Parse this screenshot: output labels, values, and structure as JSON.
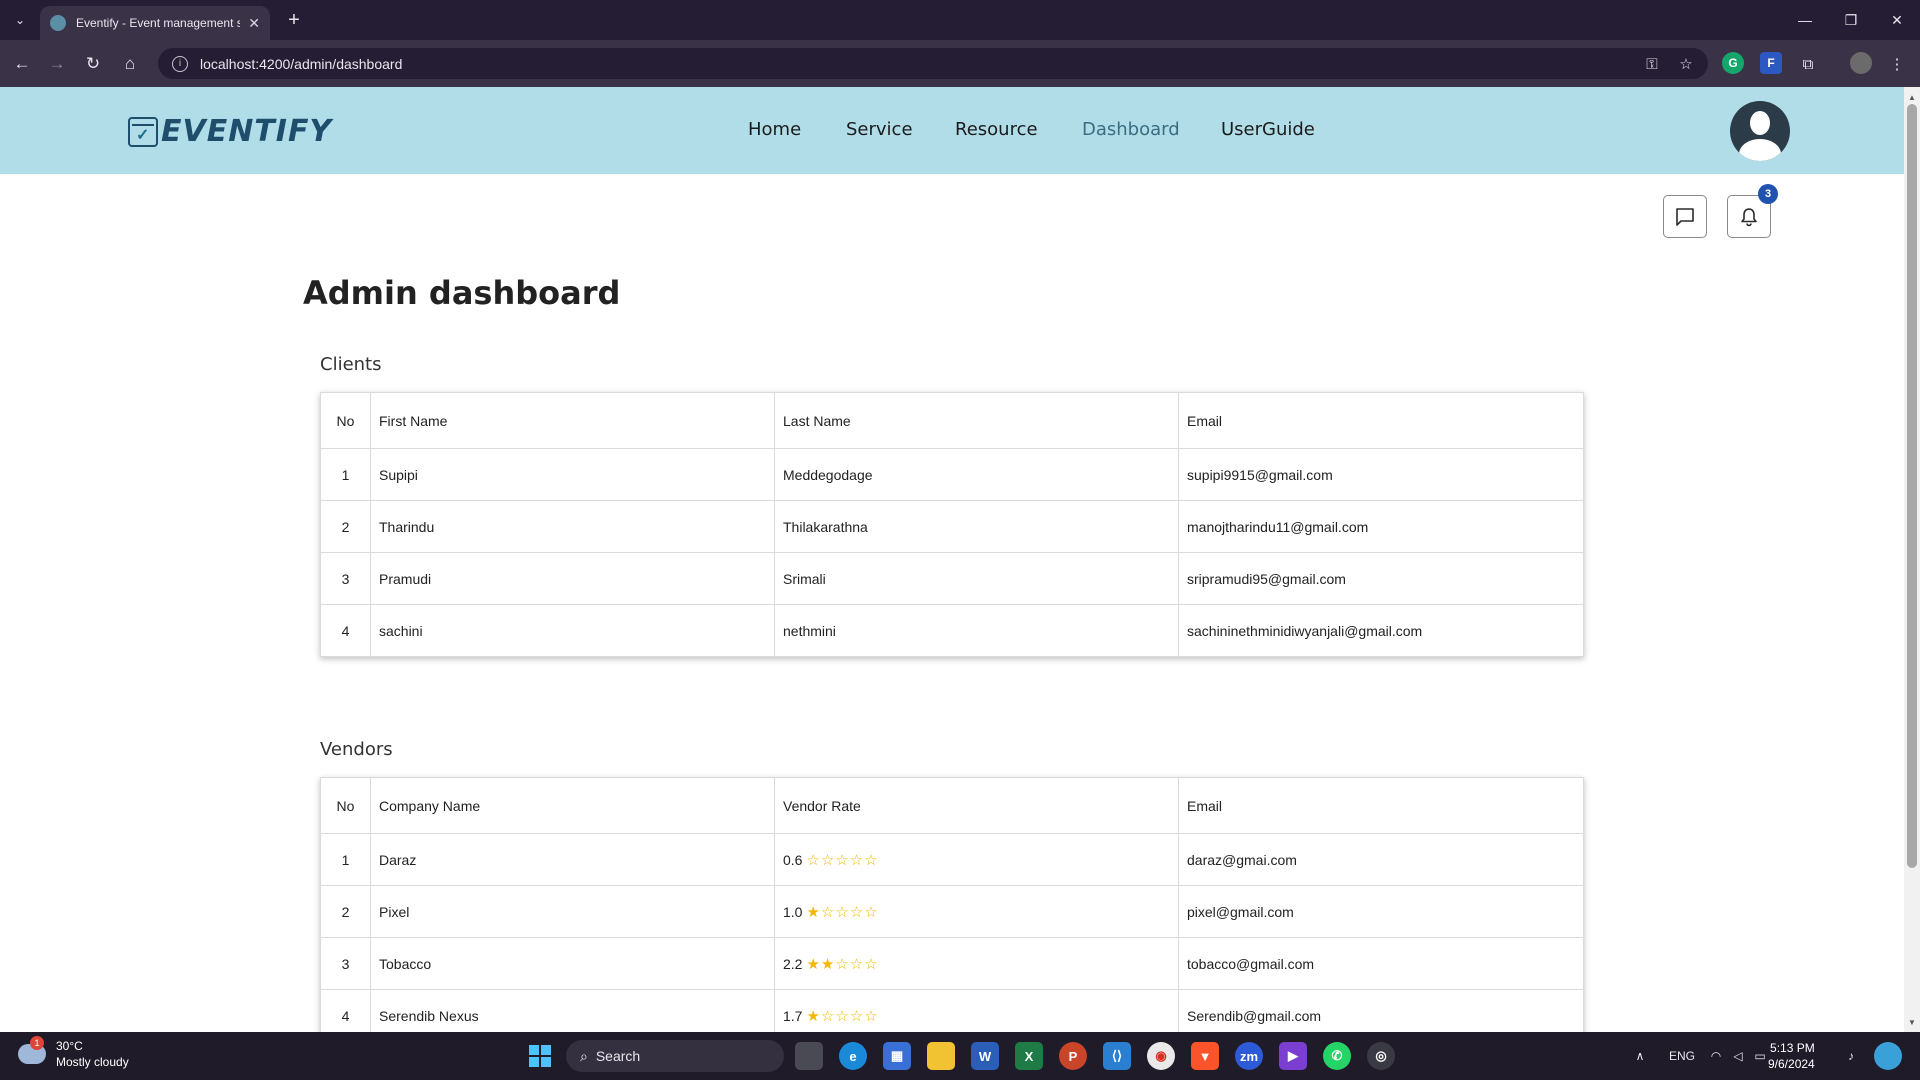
{
  "browser": {
    "tab_title": "Eventify - Event management s",
    "url": "localhost:4200/admin/dashboard",
    "new_tab": "+",
    "close_tab": "✕"
  },
  "app": {
    "logo_text": "EVENTIFY",
    "nav": [
      "Home",
      "Service",
      "Resource",
      "Dashboard",
      "UserGuide"
    ],
    "active_nav": "Dashboard",
    "notification_count": "3"
  },
  "page": {
    "title": "Admin dashboard"
  },
  "clients": {
    "title": "Clients",
    "headers": [
      "No",
      "First Name",
      "Last Name",
      "Email"
    ],
    "rows": [
      [
        "1",
        "Supipi",
        "Meddegodage",
        "supipi9915@gmail.com"
      ],
      [
        "2",
        "Tharindu",
        "Thilakarathna",
        "manojtharindu11@gmail.com"
      ],
      [
        "3",
        "Pramudi",
        "Srimali",
        "sripramudi95@gmail.com"
      ],
      [
        "4",
        "sachini",
        "nethmini",
        "sachininethminidiwyanjali@gmail.com"
      ]
    ]
  },
  "vendors": {
    "title": "Vendors",
    "headers": [
      "No",
      "Company Name",
      "Vendor Rate",
      "Email"
    ],
    "rows": [
      {
        "no": "1",
        "name": "Daraz",
        "rate": "0.6",
        "stars_filled": 0,
        "email": "daraz@gmai.com"
      },
      {
        "no": "2",
        "name": "Pixel",
        "rate": "1.0",
        "stars_filled": 1,
        "email": "pixel@gmail.com"
      },
      {
        "no": "3",
        "name": "Tobacco",
        "rate": "2.2",
        "stars_filled": 2,
        "email": "tobacco@gmail.com"
      },
      {
        "no": "4",
        "name": "Serendib Nexus",
        "rate": "1.7",
        "stars_filled": 1,
        "email": "Serendib@gmail.com"
      }
    ]
  },
  "taskbar": {
    "weather_temp": "30°C",
    "weather_desc": "Mostly cloudy",
    "weather_alert": "1",
    "search_label": "Search",
    "language": "ENG",
    "time": "5:13 PM",
    "date": "9/6/2024"
  }
}
